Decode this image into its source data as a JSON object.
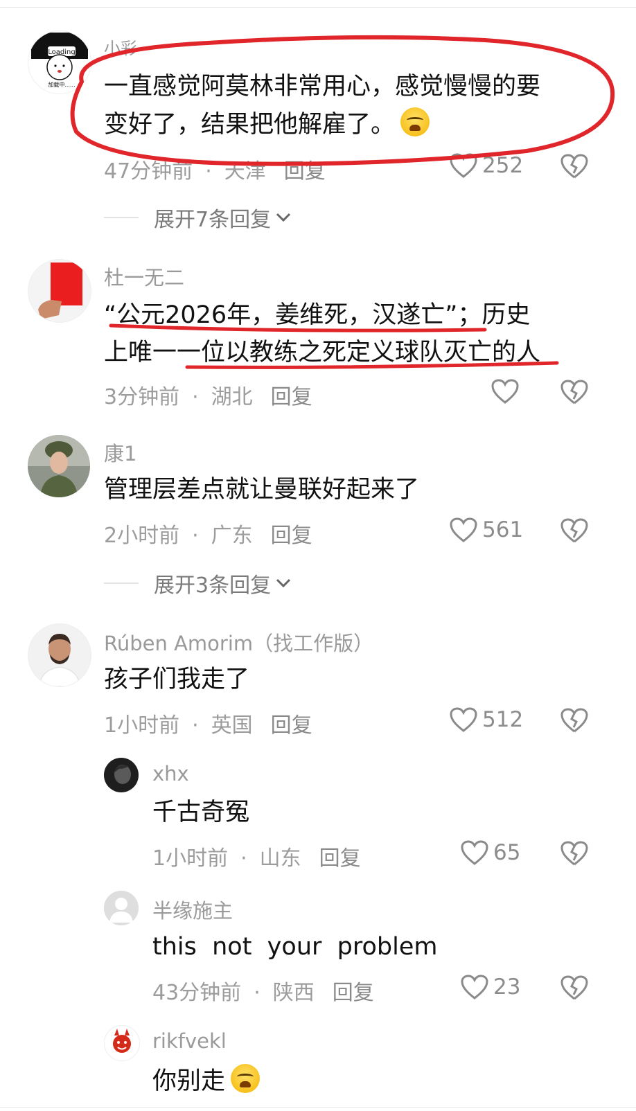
{
  "comments": [
    {
      "avatar_icon": "loading-cartoon-avatar",
      "avatar_text": [
        "Loading",
        "加载中......"
      ],
      "username": "小彩",
      "text_lines": [
        "一直感觉阿莫林非常用心，感觉慢慢的要",
        "变好了，结果把他解雇了。"
      ],
      "emoji": "crying-face-emoji",
      "time": "47分钟前",
      "location": "天津",
      "reply": "回复",
      "likes": "252",
      "expand": "展开7条回复"
    },
    {
      "avatar_icon": "red-card-avatar",
      "username": "杜一无二",
      "text_lines": [
        "“公元2026年，姜维死，汉遂亡”；历史",
        "上唯一一位以教练之死定义球队灭亡的人"
      ],
      "time": "3分钟前",
      "location": "湖北",
      "reply": "回复",
      "likes": ""
    },
    {
      "avatar_icon": "soldier-photo-avatar",
      "username": "康1",
      "text_lines": [
        "管理层差点就让曼联好起来了"
      ],
      "time": "2小时前",
      "location": "广东",
      "reply": "回复",
      "likes": "561",
      "expand": "展开3条回复"
    },
    {
      "avatar_icon": "ruben-amorim-photo-avatar",
      "username": "Rúben Amorim（找工作版）",
      "text_lines": [
        "孩子们我走了"
      ],
      "time": "1小时前",
      "location": "英国",
      "reply": "回复",
      "likes": "512"
    }
  ],
  "replies": [
    {
      "avatar_icon": "dark-photo-avatar",
      "username": "xhx",
      "text": "千古奇冤",
      "time": "1小时前",
      "location": "山东",
      "reply": "回复",
      "likes": "65"
    },
    {
      "avatar_icon": "default-user-avatar",
      "username": "半缘施主",
      "text": "this  not  your  problem",
      "time": "43分钟前",
      "location": "陕西",
      "reply": "回复",
      "likes": "23"
    },
    {
      "avatar_icon": "red-devil-avatar",
      "username": "rikfvekl",
      "text": "你别走",
      "emoji": "crying-face-emoji",
      "time": "",
      "location": "",
      "reply": "",
      "likes": ""
    }
  ],
  "annotation_color": "#e0262b",
  "dot": "·"
}
